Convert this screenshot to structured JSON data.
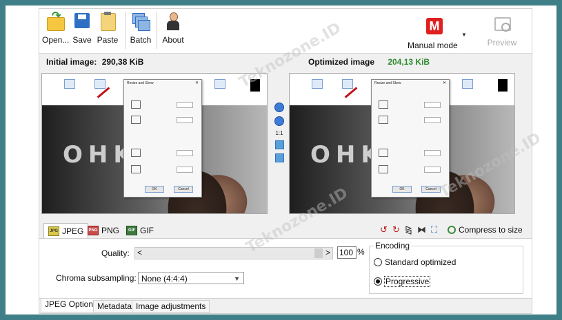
{
  "toolbar": {
    "open_label": "Open...",
    "save_label": "Save",
    "paste_label": "Paste",
    "batch_label": "Batch",
    "about_label": "About",
    "mode_icon_letter": "M",
    "mode_label": "Manual mode",
    "preview_label": "Preview"
  },
  "initial": {
    "label": "Initial image:",
    "size": "290,38 KiB"
  },
  "optimized": {
    "label": "Optimized image",
    "size": "204,13 KiB"
  },
  "pane_preview": {
    "photo_text": "OHK",
    "dialog_title": "Resize and Skew",
    "ok_label": "OK",
    "cancel_label": "Cancel"
  },
  "mid_tools": {
    "one_to_one": "1:1"
  },
  "format_tabs": [
    {
      "icon": "jpeg-icon",
      "icon_text": "JPG",
      "label": "JPEG"
    },
    {
      "icon": "png-icon",
      "icon_text": "PNG",
      "label": "PNG"
    },
    {
      "icon": "gif-icon",
      "icon_text": "GIF",
      "label": "GIF"
    }
  ],
  "compress_label": "Compress to size",
  "options": {
    "quality_label": "Quality:",
    "quality_value": "100",
    "quality_unit": "%",
    "slider_left": "<",
    "slider_right": ">",
    "chroma_label": "Chroma subsampling:",
    "chroma_value": "None (4:4:4)",
    "encoding_legend": "Encoding",
    "radio_standard": "Standard optimized",
    "radio_progressive": "Progressive",
    "selected_encoding": "Progressive"
  },
  "bottom_tabs": [
    "JPEG Options",
    "Metadata",
    "Image adjustments"
  ],
  "watermark": "Teknozone.ID",
  "colors": {
    "frame": "#3f7f87",
    "accent_green": "#2e8b2e",
    "mode_red": "#e02020"
  }
}
